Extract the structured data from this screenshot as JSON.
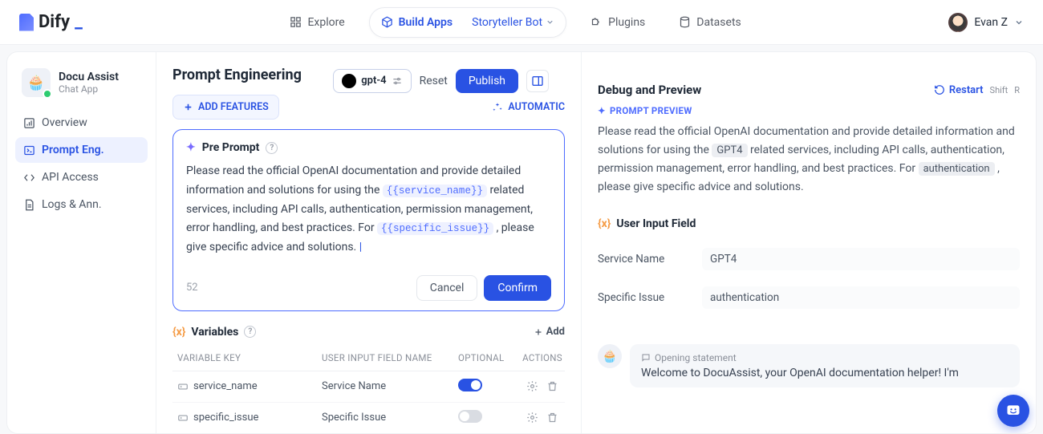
{
  "brand": "Dify",
  "topnav": {
    "explore": "Explore",
    "build": "Build Apps",
    "bot": "Storyteller Bot",
    "plugins": "Plugins",
    "datasets": "Datasets"
  },
  "user": {
    "name": "Evan Z"
  },
  "app": {
    "name": "Docu Assist",
    "type": "Chat App",
    "emoji": "🧁"
  },
  "sidebar": {
    "overview": "Overview",
    "prompt": "Prompt Eng.",
    "api": "API Access",
    "logs": "Logs & Ann."
  },
  "page": {
    "title": "Prompt Engineering",
    "model": "gpt-4",
    "reset": "Reset",
    "publish": "Publish"
  },
  "toolbar": {
    "addFeatures": "ADD FEATURES",
    "automatic": "AUTOMATIC"
  },
  "preprompt": {
    "label": "Pre Prompt",
    "text1": "Please read the official OpenAI documentation and provide detailed information and solutions for using the ",
    "var1": "{{service_name}}",
    "text2": " related services, including API calls, authentication, permission management, error handling, and best practices. For ",
    "var2": "{{specific_issue}}",
    "text3": " , please give specific advice and solutions. ",
    "count": "52",
    "cancel": "Cancel",
    "confirm": "Confirm"
  },
  "variables": {
    "label": "Variables",
    "add": "Add",
    "headers": {
      "key": "VARIABLE KEY",
      "name": "USER INPUT FIELD NAME",
      "optional": "OPTIONAL",
      "actions": "ACTIONS"
    },
    "rows": [
      {
        "key": "service_name",
        "name": "Service Name",
        "optional": true
      },
      {
        "key": "specific_issue",
        "name": "Specific Issue",
        "optional": false
      }
    ]
  },
  "debug": {
    "title": "Debug and Preview",
    "restart": "Restart",
    "shortcut1": "Shift",
    "shortcut2": "R",
    "previewLabel": "PROMPT PREVIEW",
    "preview1": "Please read the official OpenAI documentation and provide detailed information and solutions for using the ",
    "fill1": "GPT4",
    "preview2": " related services, including API calls, authentication, permission management, error handling, and best practices. For ",
    "fill2": "authentication",
    "preview3": " , please give specific advice and solutions."
  },
  "userInput": {
    "label": "User Input Field",
    "rows": [
      {
        "name": "Service Name",
        "value": "GPT4"
      },
      {
        "name": "Specific Issue",
        "value": "authentication"
      }
    ]
  },
  "chat": {
    "emoji": "🧁",
    "openLabel": "Opening statement",
    "text": "Welcome to DocuAssist, your OpenAI documentation helper! I'm"
  }
}
